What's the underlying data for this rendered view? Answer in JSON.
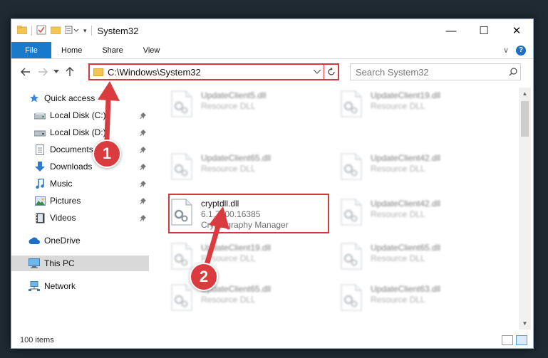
{
  "window": {
    "title": "System32",
    "controls": {
      "minimize": "—",
      "maximize": "☐",
      "close": "✕"
    }
  },
  "ribbon": {
    "tabs": [
      "File",
      "Home",
      "Share",
      "View"
    ],
    "expand_icon": "∨",
    "help_label": "?"
  },
  "address": {
    "path": "C:\\Windows\\System32",
    "search_placeholder": "Search System32"
  },
  "nav": {
    "quick_access": "Quick access",
    "items": [
      {
        "label": "Local Disk (C:)",
        "icon": "drive-icon"
      },
      {
        "label": "Local Disk (D:)",
        "icon": "drive-icon"
      },
      {
        "label": "Documents",
        "icon": "documents-icon"
      },
      {
        "label": "Downloads",
        "icon": "downloads-icon"
      },
      {
        "label": "Music",
        "icon": "music-icon"
      },
      {
        "label": "Pictures",
        "icon": "pictures-icon"
      },
      {
        "label": "Videos",
        "icon": "videos-icon"
      }
    ],
    "onedrive": "OneDrive",
    "this_pc": "This PC",
    "network": "Network"
  },
  "files": [
    {
      "name": "UpdateClient5.dll",
      "line2": "Resource DLL",
      "line3": ""
    },
    {
      "name": "UpdateClient19.dll",
      "line2": "Resource DLL",
      "line3": ""
    },
    {
      "name": "UpdateClient65.dll",
      "line2": "Resource DLL",
      "line3": ""
    },
    {
      "name": "UpdateClient42.dll",
      "line2": "Resource DLL",
      "line3": ""
    },
    {
      "name": "cryptdll.dll",
      "line2": "6.1.7600.16385",
      "line3": "Cryptography Manager"
    },
    {
      "name": "UpdateClient42.dll",
      "line2": "Resource DLL",
      "line3": ""
    },
    {
      "name": "UpdateClient19.dll",
      "line2": "Resource DLL",
      "line3": ""
    },
    {
      "name": "UpdateClient65.dll",
      "line2": "Resource DLL",
      "line3": ""
    },
    {
      "name": "UpdateClient65.dll",
      "line2": "Resource DLL",
      "line3": ""
    },
    {
      "name": "UpdateClient63.dll",
      "line2": "Resource DLL",
      "line3": ""
    }
  ],
  "status": {
    "item_count": "100 items"
  },
  "annotations": {
    "step1": "1",
    "step2": "2"
  },
  "colors": {
    "highlight": "#d33a3f",
    "file_tab": "#1979ca",
    "badge": "#d93b3e"
  }
}
